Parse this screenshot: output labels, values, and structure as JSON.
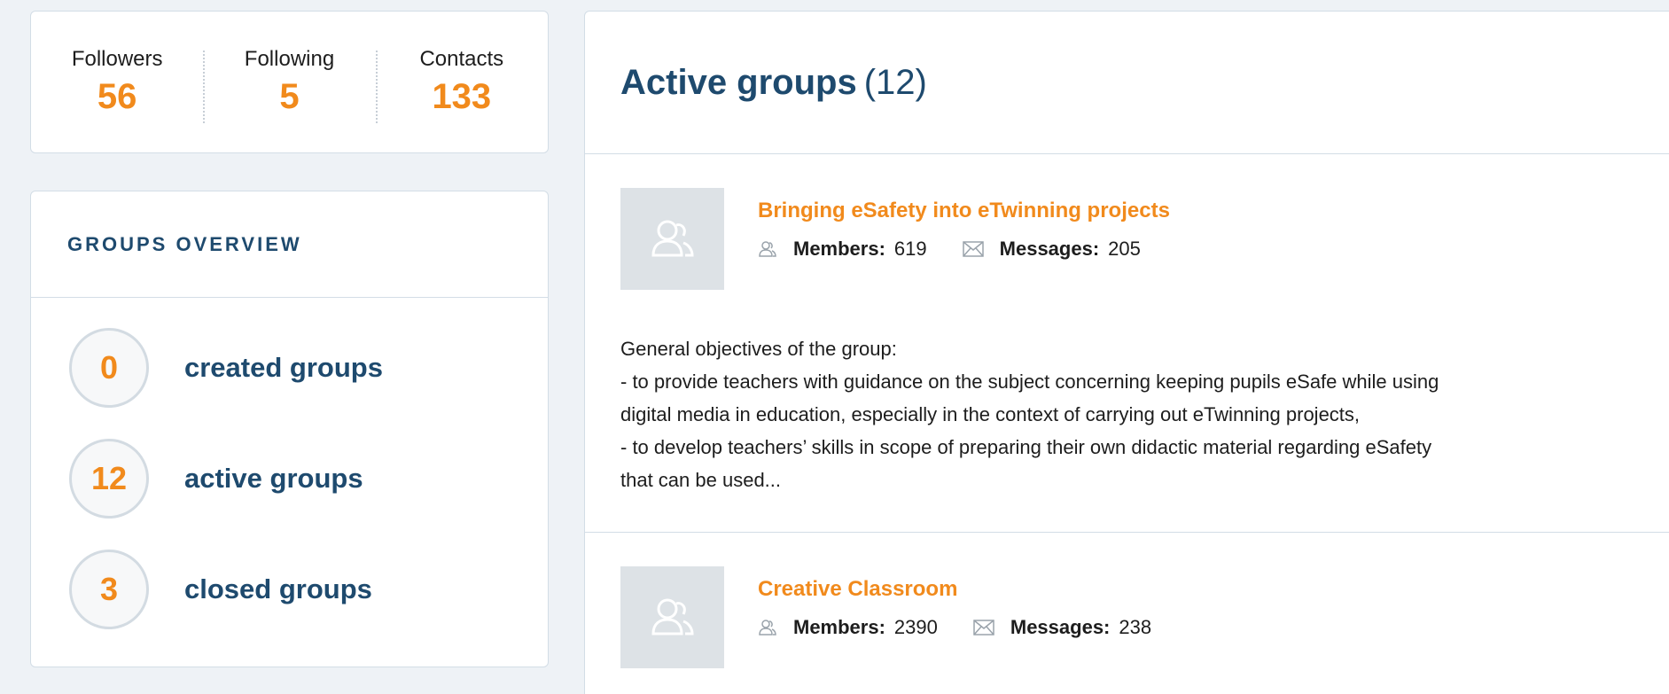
{
  "stats": [
    {
      "label": "Followers",
      "value": "56"
    },
    {
      "label": "Following",
      "value": "5"
    },
    {
      "label": "Contacts",
      "value": "133"
    }
  ],
  "overview": {
    "title": "GROUPS OVERVIEW",
    "items": [
      {
        "count": "0",
        "label": "created groups"
      },
      {
        "count": "12",
        "label": "active groups"
      },
      {
        "count": "3",
        "label": "closed groups"
      }
    ]
  },
  "active_groups": {
    "title": "Active groups",
    "count": "(12)",
    "groups": [
      {
        "name": "Bringing eSafety into eTwinning projects",
        "members_label": "Members:",
        "members": "619",
        "messages_label": "Messages:",
        "messages": "205",
        "description": [
          "General objectives of the group:",
          "- to provide teachers with guidance on the subject concerning keeping pupils eSafe while using",
          "digital media in education, especially in the context of carrying out eTwinning projects,",
          "- to develop teachers’ skills in scope of preparing their own didactic material regarding eSafety",
          "that can be used..."
        ]
      },
      {
        "name": "Creative Classroom",
        "members_label": "Members:",
        "members": "2390",
        "messages_label": "Messages:",
        "messages": "238"
      }
    ]
  },
  "colors": {
    "accent": "#f18a1c",
    "heading": "#1e4a6e",
    "background": "#eef2f6"
  },
  "icons": [
    "avatar-placeholder-icon",
    "members-icon",
    "messages-icon"
  ]
}
